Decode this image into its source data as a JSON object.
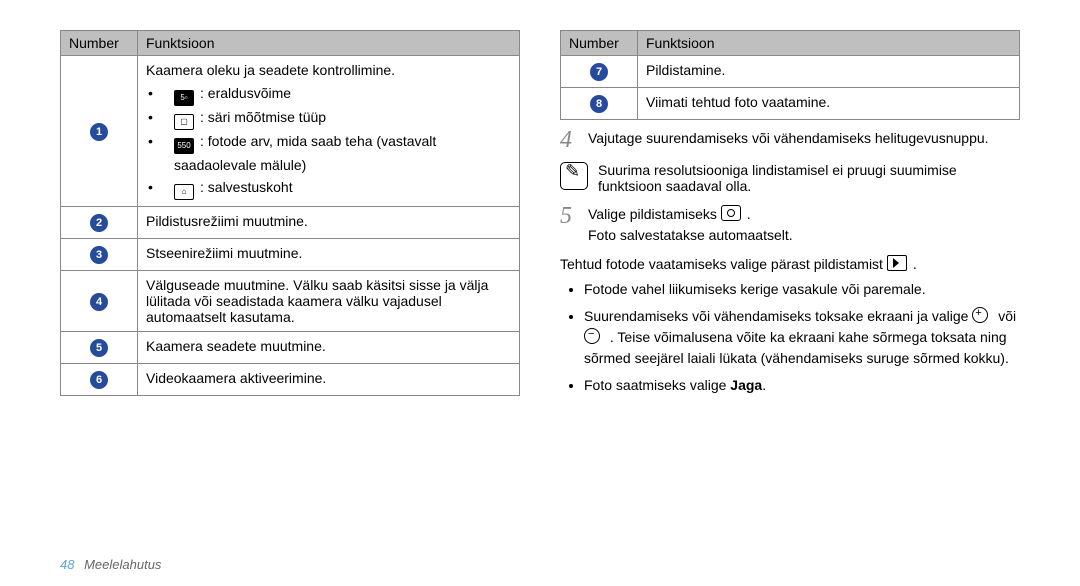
{
  "table_left": {
    "headers": [
      "Number",
      "Funktsioon"
    ],
    "row1_desc": "Kaamera oleku ja seadete kontrollimine.",
    "row1_bullets": [
      ": eraldusvõime",
      ": säri mõõtmise tüüp",
      ": fotode arv, mida saab teha (vastavalt saadaolevale mälule)",
      ": salvestuskoht"
    ],
    "row2": "Pildistusrežiimi muutmine.",
    "row3": "Stseenirežiimi muutmine.",
    "row4": "Välguseade muutmine. Välku saab käsitsi sisse ja välja lülitada või seadistada kaamera välku vajadusel automaatselt kasutama.",
    "row5": "Kaamera seadete muutmine.",
    "row6": "Videokaamera aktiveerimine."
  },
  "table_right": {
    "headers": [
      "Number",
      "Funktsioon"
    ],
    "row7": "Pildistamine.",
    "row8": "Viimati tehtud foto vaatamine."
  },
  "step4": "Vajutage suurendamiseks või vähendamiseks helitugevusnuppu.",
  "note": "Suurima resolutsiooniga lindistamisel ei pruugi suumimise funktsioon saadaval olla.",
  "step5a": "Valige pildistamiseks ",
  "step5b": "Foto salvestatakse automaatselt.",
  "after5": "Tehtud fotode vaatamiseks valige pärast pildistamist ",
  "bullets": {
    "b1": "Fotode vahel liikumiseks kerige vasakule või paremale.",
    "b2a": "Suurendamiseks või vähendamiseks toksake ekraani ja valige ",
    "b2b": " või ",
    "b2c": " . Teise võimalusena võite ka ekraani kahe sõrmega toksata ning sõrmed seejärel laiali lükata (vähendamiseks suruge sõrmed kokku).",
    "b3a": "Foto saatmiseks valige ",
    "b3b": "Jaga",
    "b3c": "."
  },
  "footer": {
    "page": "48",
    "section": "Meelelahutus"
  }
}
